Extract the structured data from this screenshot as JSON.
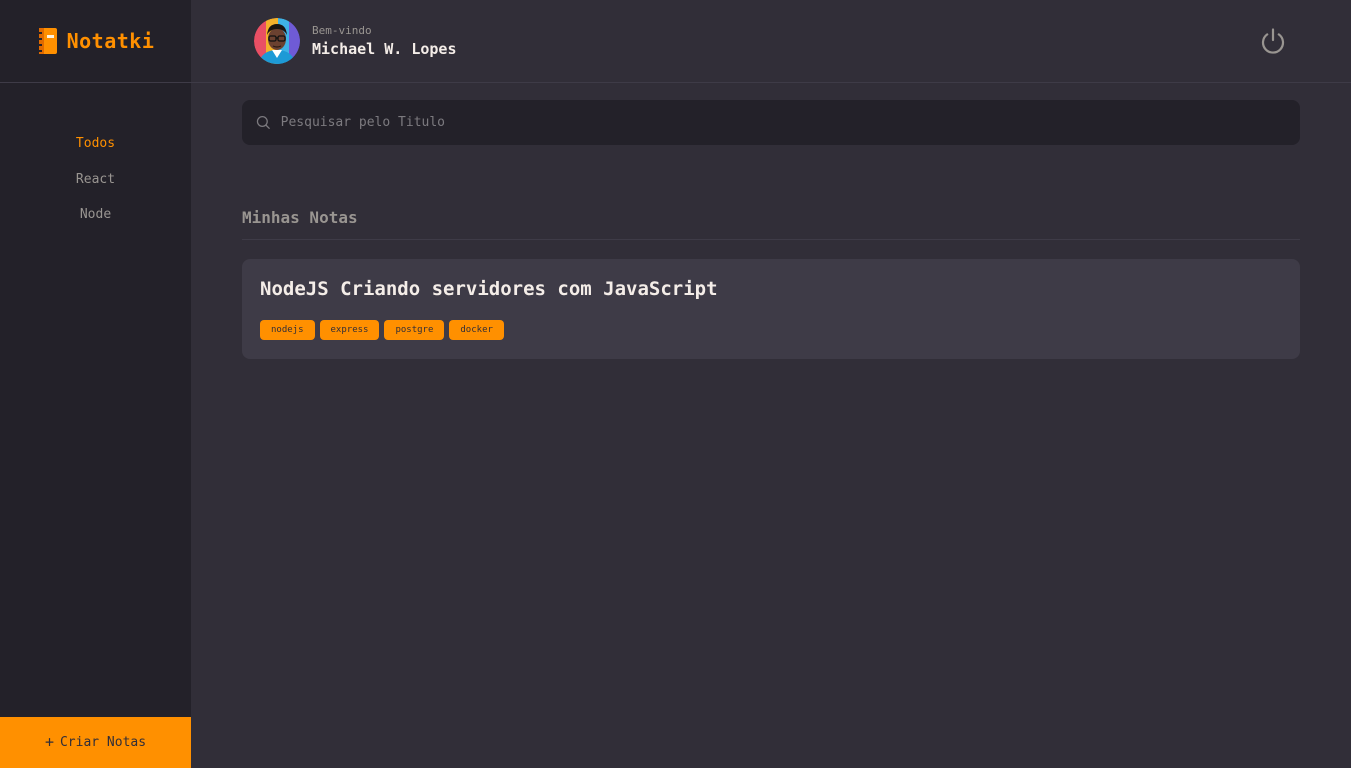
{
  "brand": {
    "name": "Notatki",
    "logo_icon": "notebook-icon",
    "accent": "#ff9000"
  },
  "sidebar": {
    "items": [
      {
        "label": "Todos",
        "active": true
      },
      {
        "label": "React",
        "active": false
      },
      {
        "label": "Node",
        "active": false
      }
    ],
    "create_button": {
      "icon": "plus-icon",
      "label": "Criar Notas"
    }
  },
  "header": {
    "greeting": "Bem-vindo",
    "user_name": "Michael W. Lopes",
    "logout_icon": "power-icon"
  },
  "search": {
    "placeholder": "Pesquisar pelo Titulo",
    "value": ""
  },
  "section": {
    "title": "Minhas Notas"
  },
  "notes": [
    {
      "title": "NodeJS Criando servidores com JavaScript",
      "tags": [
        "nodejs",
        "express",
        "postgre",
        "docker"
      ]
    }
  ],
  "colors": {
    "background": "#312e38",
    "sidebar": "#232129",
    "card": "#3e3b47",
    "accent": "#ff9000",
    "text": "#f4ede8",
    "muted": "#999591"
  }
}
